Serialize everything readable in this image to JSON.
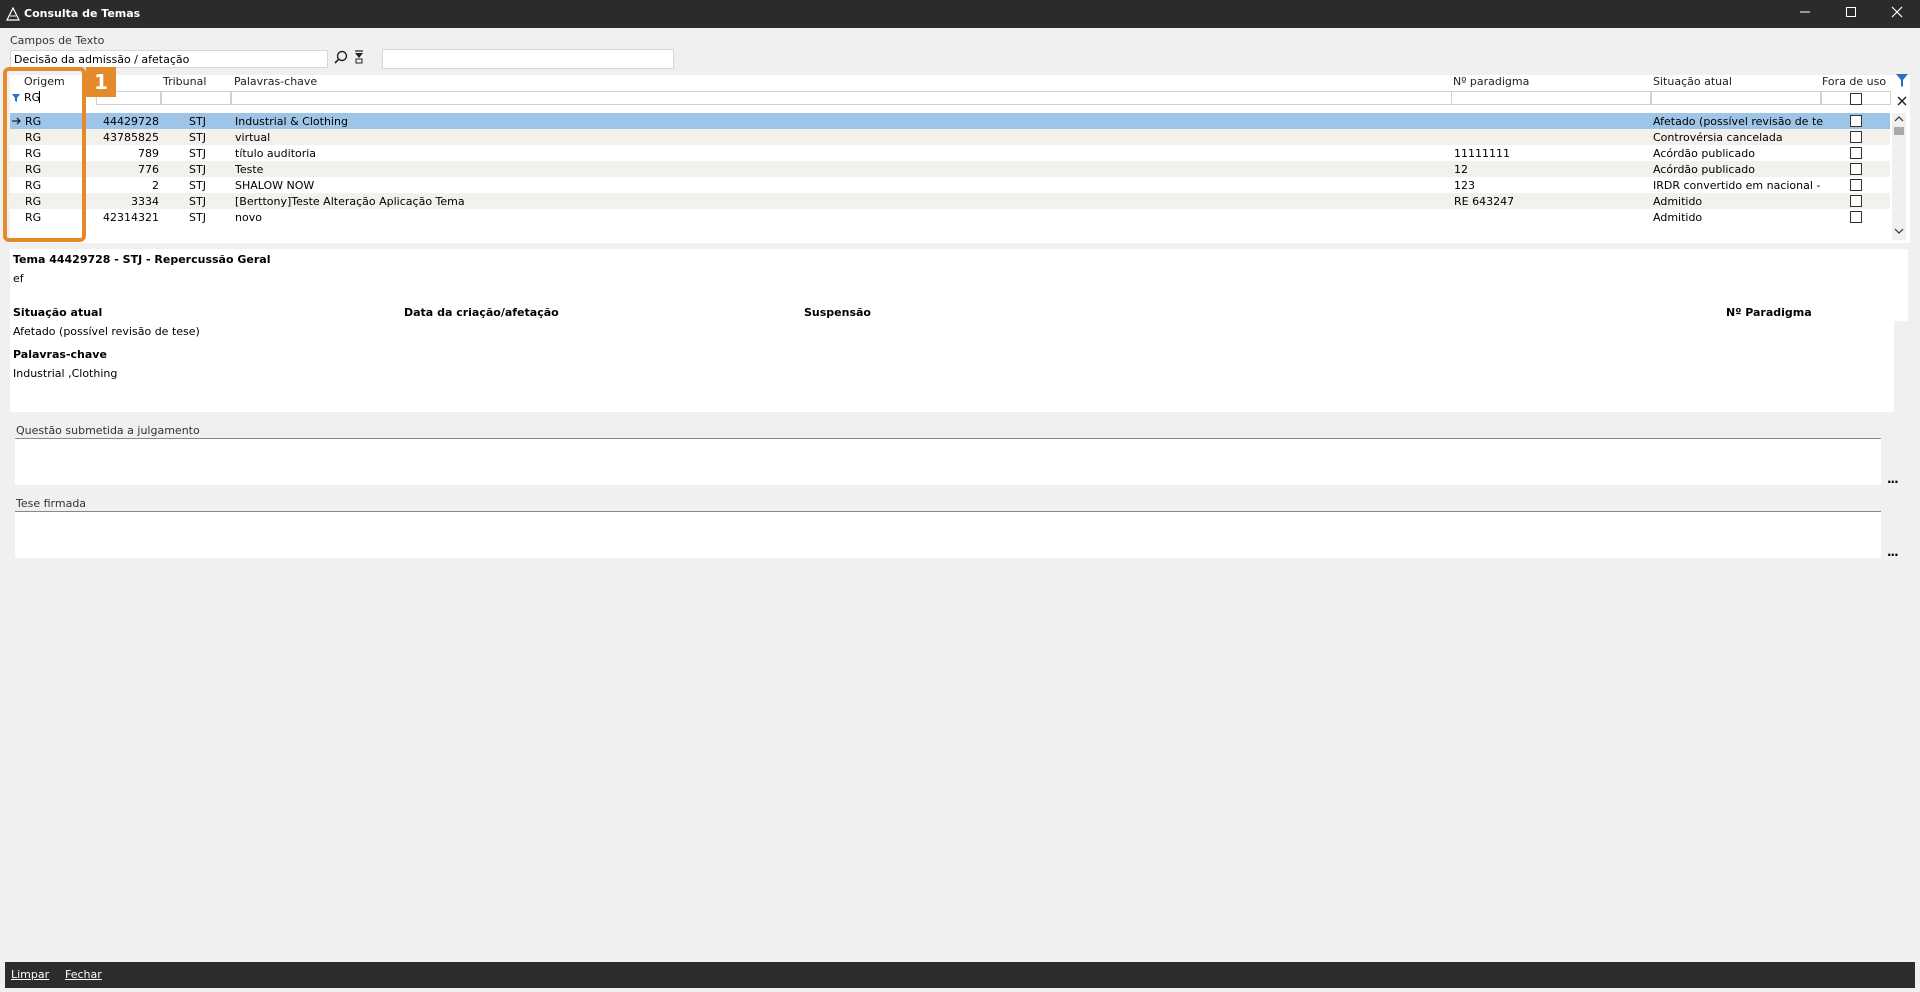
{
  "window": {
    "title": "Consulta de Temas"
  },
  "campos": {
    "label": "Campos de Texto",
    "field_value": "Decisão da admissão / afetação",
    "second_value": ""
  },
  "columns": [
    "Origem",
    "",
    "Tribunal",
    "Palavras-chave",
    "Nº paradigma",
    "Situação atual",
    "Fora de uso"
  ],
  "filter": {
    "origem": "RG"
  },
  "rows": [
    {
      "origem": "RG",
      "numero": "44429728",
      "tribunal": "STJ",
      "palavras": "Industrial & Clothing",
      "paradigma": "",
      "situacao": "Afetado (possível revisão de tese)",
      "fora": false
    },
    {
      "origem": "RG",
      "numero": "43785825",
      "tribunal": "STJ",
      "palavras": "virtual",
      "paradigma": "",
      "situacao": "Controvérsia cancelada",
      "fora": false
    },
    {
      "origem": "RG",
      "numero": "789",
      "tribunal": "STJ",
      "palavras": "título auditoria",
      "paradigma": "11111111",
      "situacao": "Acórdão publicado",
      "fora": false
    },
    {
      "origem": "RG",
      "numero": "776",
      "tribunal": "STJ",
      "palavras": "Teste",
      "paradigma": "12",
      "situacao": "Acórdão publicado",
      "fora": false
    },
    {
      "origem": "RG",
      "numero": "2",
      "tribunal": "STJ",
      "palavras": "SHALOW NOW",
      "paradigma": "123",
      "situacao": "IRDR convertido em nacional - ST",
      "fora": false
    },
    {
      "origem": "RG",
      "numero": "3334",
      "tribunal": "STJ",
      "palavras": "[Berttony]Teste Alteração Aplicação Tema",
      "paradigma": "RE 643247",
      "situacao": "Admitido",
      "fora": false
    },
    {
      "origem": "RG",
      "numero": "42314321",
      "tribunal": "STJ",
      "palavras": "novo",
      "paradigma": "",
      "situacao": "Admitido",
      "fora": false
    }
  ],
  "detail": {
    "tema_title": "Tema 44429728 - STJ - Repercussão Geral",
    "ef": "ef",
    "situacao_label": "Situação atual",
    "data_label": "Data da criação/afetação",
    "suspensao_label": "Suspensão",
    "paradigma_label": "Nº Paradigma",
    "situacao_value": "Afetado (possível revisão de tese)",
    "palavras_label": "Palavras-chave",
    "palavras_value": "Industrial ,Clothing"
  },
  "sections": {
    "questao": "Questão submetida a julgamento",
    "tese": "Tese firmada",
    "ellipsis": "..."
  },
  "bottom": {
    "limpar": "Limpar",
    "fechar": "Fechar"
  },
  "callout": {
    "number": "1"
  },
  "colors": {
    "highlight": "#e58a2a",
    "selected_row": "#9ec5e8",
    "title_bar": "#2b2b2b"
  }
}
